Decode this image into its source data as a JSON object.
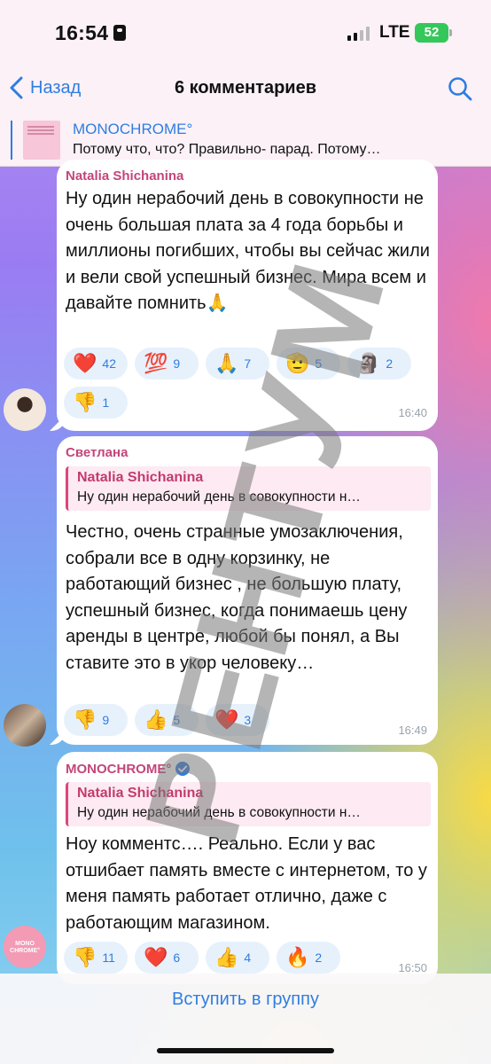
{
  "status_bar": {
    "time": "16:54",
    "network": "LTE",
    "battery": "52"
  },
  "header": {
    "back_label": "Назад",
    "title": "6 комментариев"
  },
  "pinned": {
    "title": "MONOCHROME°",
    "text": "Потому что, что? Правильно- парад. Потому…"
  },
  "messages": [
    {
      "sender": "Natalia Shichanina",
      "text": "Ну один нерабочий день в совокупности не очень большая плата за 4 года борьбы и миллионы погибших, чтобы вы сейчас жили и вели свой успешный бизнес. Мира всем и давайте помнить🙏",
      "reactions": [
        {
          "emoji": "❤️",
          "count": "42"
        },
        {
          "emoji": "💯",
          "count": "9"
        },
        {
          "emoji": "🙏",
          "count": "7"
        },
        {
          "emoji": "🫡",
          "count": "5"
        },
        {
          "emoji": "🗿",
          "count": "2"
        },
        {
          "emoji": "👎",
          "count": "1"
        }
      ],
      "time": "16:40"
    },
    {
      "sender": "Светлана",
      "reply": {
        "name": "Natalia Shichanina",
        "text": "Ну один нерабочий день в совокупности н…"
      },
      "text": "Честно, очень странные умозаключения, собрали все в одну корзинку, не работающий бизнес , не большую плату, успешный бизнес, когда понимаешь цену аренды в центре, любой бы понял, а Вы ставите это в укор человеку…",
      "reactions": [
        {
          "emoji": "👎",
          "count": "9"
        },
        {
          "emoji": "👍",
          "count": "5"
        },
        {
          "emoji": "❤️",
          "count": "3"
        }
      ],
      "time": "16:49"
    },
    {
      "sender": "MONOCHROME°",
      "reply": {
        "name": "Natalia Shichanina",
        "text": "Ну один нерабочий день в совокупности н…"
      },
      "text": "Ноу комментс…. Реально. Если у вас отшибает память вместе с интернетом, то у меня память работает отлично, даже с работающим магазином.",
      "reactions": [
        {
          "emoji": "👎",
          "count": "11"
        },
        {
          "emoji": "❤️",
          "count": "6"
        },
        {
          "emoji": "👍",
          "count": "4"
        },
        {
          "emoji": "🔥",
          "count": "2"
        }
      ],
      "time": "16:50"
    }
  ],
  "avatar3_text": "MONO CHROME°",
  "watermark": "РЕНТУМ",
  "bottom": {
    "join_label": "Вступить в группу"
  }
}
